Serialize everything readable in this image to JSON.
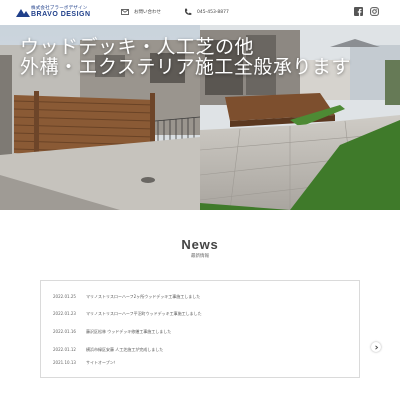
{
  "header": {
    "logo_subtitle": "株式会社ブラーボデザイン",
    "logo_title": "BRAVO DESIGN",
    "contact_label": "お問い合わせ",
    "phone": "045-453-8877",
    "social": [
      "facebook-icon",
      "instagram-icon"
    ]
  },
  "hero": {
    "line1": "ウッドデッキ・人工芝の他",
    "line2": "外構・エクステリア施工全般承ります"
  },
  "news": {
    "title": "News",
    "subtitle": "最新情報",
    "items": [
      {
        "date": "2022.01.25",
        "text": "マリノストリスローハーフ2ヶ所ウッドデッキ工事施工しました"
      },
      {
        "date": "2022.01.23",
        "text": "マリノストリスローハーフ平沼町ウッドデッキ工事施工しました"
      },
      {
        "date": "2022.01.16",
        "text": "藤沢区松林 ウッドデッキ修繕工事施工しました"
      },
      {
        "date": "2022.01.12",
        "text": "横浜市緑区安藤 人工芝施工が完成しました"
      },
      {
        "date": "2021.10.13",
        "text": "サイトオープン！"
      }
    ]
  },
  "colors": {
    "brand": "#1f3f8a",
    "wood": "#8a5a35",
    "grass": "#3f7a2a",
    "paving": "#b9b6b0"
  }
}
